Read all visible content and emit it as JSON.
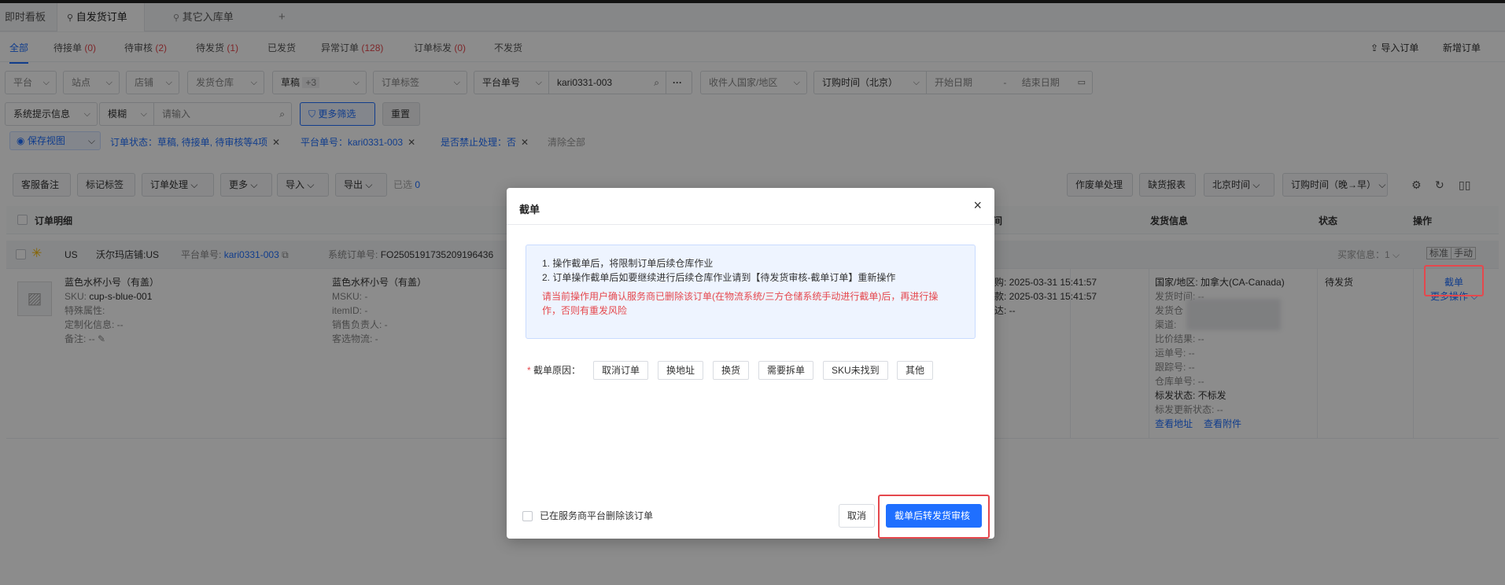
{
  "app_tabs": [
    {
      "label": "即时看板"
    },
    {
      "label": "自发货订单"
    },
    {
      "label": "其它入库单"
    }
  ],
  "add_tab": "+",
  "status_tabs": [
    {
      "label": "全部",
      "count": ""
    },
    {
      "label": "待接单",
      "count": "(0)"
    },
    {
      "label": "待审核",
      "count": "(2)"
    },
    {
      "label": "待发货",
      "count": "(1)"
    },
    {
      "label": "已发货",
      "count": ""
    },
    {
      "label": "异常订单",
      "count": "(128)"
    },
    {
      "label": "订单标发",
      "count": "(0)"
    },
    {
      "label": "不发货",
      "count": ""
    }
  ],
  "header_actions": {
    "import": "导入订单",
    "add": "新增订单"
  },
  "filters": {
    "platform": "平台",
    "site": "站点",
    "shop": "店铺",
    "warehouse": "发货仓库",
    "draft": "草稿",
    "draft_more": "+3",
    "order_tag": "订单标签",
    "platform_no_label": "平台单号",
    "platform_no_value": "kari0331-003",
    "more": "···",
    "country": "收件人国家/地区",
    "time_type": "订购时间（北京）",
    "start_date": "开始日期",
    "dash": "-",
    "end_date": "结束日期",
    "sys_info": "系统提示信息",
    "fuzzy": "模糊",
    "input_placeholder": "请输入",
    "more_filter": "更多筛选",
    "reset": "重置"
  },
  "active_tags": {
    "save_view": "保存视图",
    "status": "订单状态：草稿, 待接单, 待审核等4项",
    "platform_no": "平台单号：kari0331-003",
    "forbidden": "是否禁止处理：否",
    "clear": "清除全部"
  },
  "toolbar": {
    "cs_note": "客服备注",
    "mark_tag": "标记标签",
    "order_process": "订单处理",
    "more": "更多",
    "import": "导入",
    "export": "导出",
    "selected_label": "已选",
    "selected_count": "0",
    "void": "作废单处理",
    "shortage": "缺货报表",
    "timezone": "北京时间",
    "sort": "订购时间（晚→早）"
  },
  "table": {
    "headers": {
      "detail": "订单明细",
      "time": "间",
      "ship": "发货信息",
      "status": "状态",
      "ops": "操作"
    },
    "group": {
      "country": "US",
      "shop": "沃尔玛店铺:US",
      "platform_no_label": "平台单号:",
      "platform_no": "kari0331-003",
      "system_no_label": "系统订单号:",
      "system_no": "FO2505191735209196436",
      "buyer_info": "买家信息：",
      "buyer_count": "1",
      "tag_standard": "标准",
      "tag_manual": "手动"
    },
    "row": {
      "product_name": "蓝色水杯小号（有盖）",
      "sku_label": "SKU:",
      "sku": "cup-s-blue-001",
      "special": "特殊属性:",
      "custom": "定制化信息: --",
      "remark": "备注: --",
      "product_name2": "蓝色水杯小号（有盖）",
      "msku": "MSKU: -",
      "item_id": "itemID: -",
      "sales_owner": "销售负责人: -",
      "logistics": "客选物流: -",
      "time1": "购: 2025-03-31 15:41:57",
      "time2": "款: 2025-03-31 15:41:57",
      "time3": "达: --",
      "country": "国家/地区: 加拿大(CA-Canada)",
      "ship_time": "发货时间: --",
      "ship_wh": "发货仓",
      "channel": "渠道:",
      "compare": "比价结果: --",
      "waybill": "运单号: --",
      "tracking": "跟踪号: --",
      "wh_no": "仓库单号: --",
      "mark_status": "标发状态: 不标发",
      "mark_update": "标发更新状态: --",
      "view_addr": "查看地址",
      "view_attach": "查看附件",
      "status": "待发货",
      "cut_order": "截单",
      "more_ops": "更多操作"
    }
  },
  "modal": {
    "title": "截单",
    "close": "×",
    "notice_1": "1. 操作截单后，将限制订单后续仓库作业",
    "notice_2": "2. 订单操作截单后如要继续进行后续仓库作业请到【待发货审核-截单订单】重新操作",
    "warning": "请当前操作用户确认服务商已删除该订单(在物流系统/三方仓储系统手动进行截单)后，再进行操作，否则有重发风险",
    "reason_label": "截单原因：",
    "reasons": [
      "取消订单",
      "换地址",
      "换货",
      "需要拆单",
      "SKU未找到",
      "其他"
    ],
    "deleted_checkbox": "已在服务商平台删除该订单",
    "cancel": "取消",
    "confirm": "截单后转发货审核"
  },
  "colors": {
    "accent": "#1f6fff",
    "danger": "#e5484d",
    "notice_bg": "#eef4ff"
  }
}
